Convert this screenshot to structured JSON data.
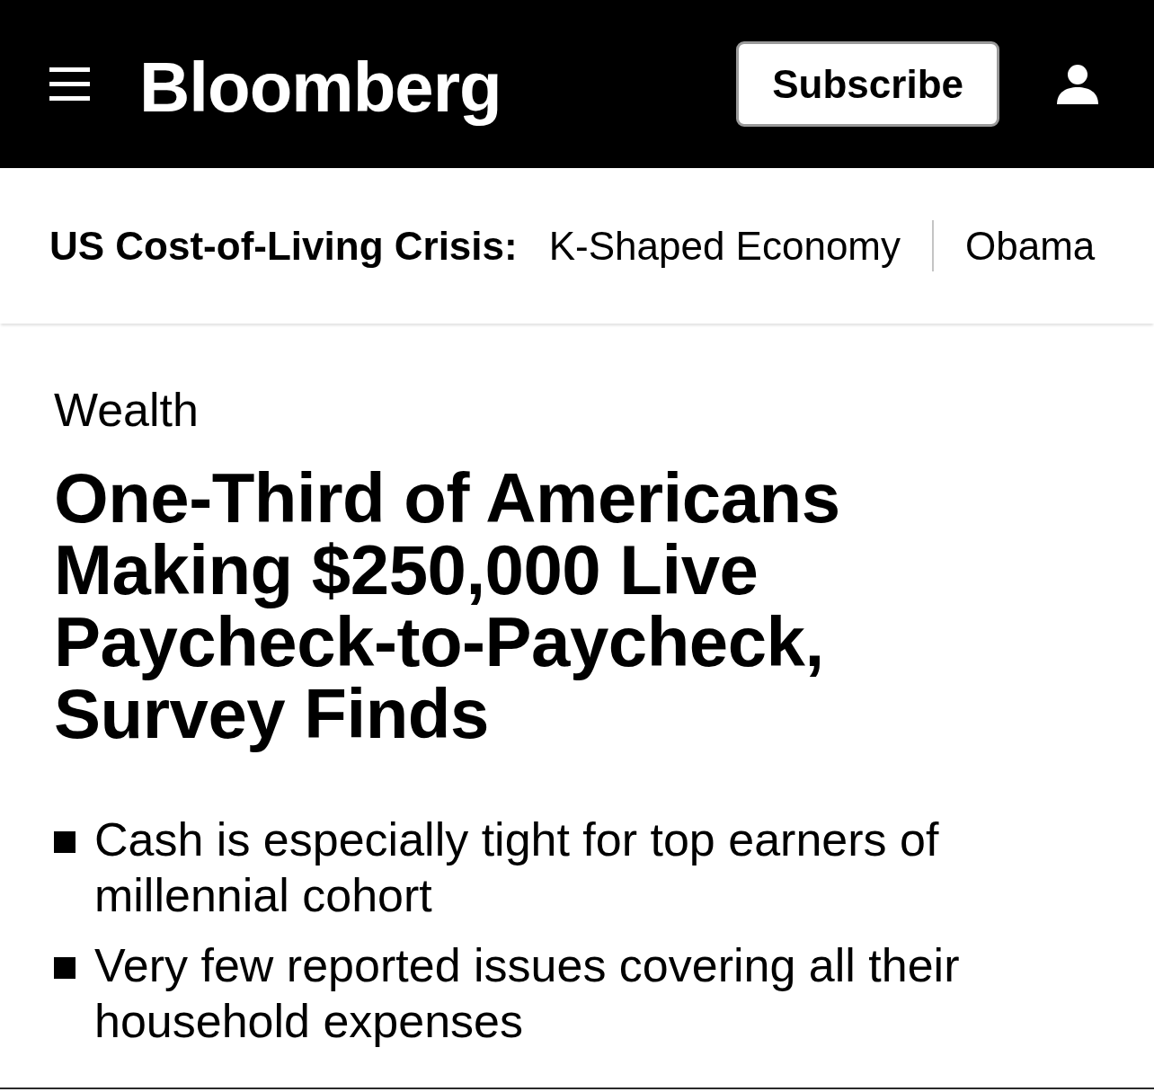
{
  "header": {
    "logo": "Bloomberg",
    "subscribe_button": "Subscribe"
  },
  "topic_bar": {
    "label": "US Cost-of-Living Crisis:",
    "links": [
      "K-Shaped Economy",
      "Obama"
    ]
  },
  "article": {
    "section": "Wealth",
    "headline": "One-Third of Americans Making $250,000 Live Paycheck-to-Paycheck, Survey Finds",
    "bullets": [
      "Cash is especially tight for top earners of millennial cohort",
      "Very few reported issues covering all their household expenses"
    ]
  }
}
